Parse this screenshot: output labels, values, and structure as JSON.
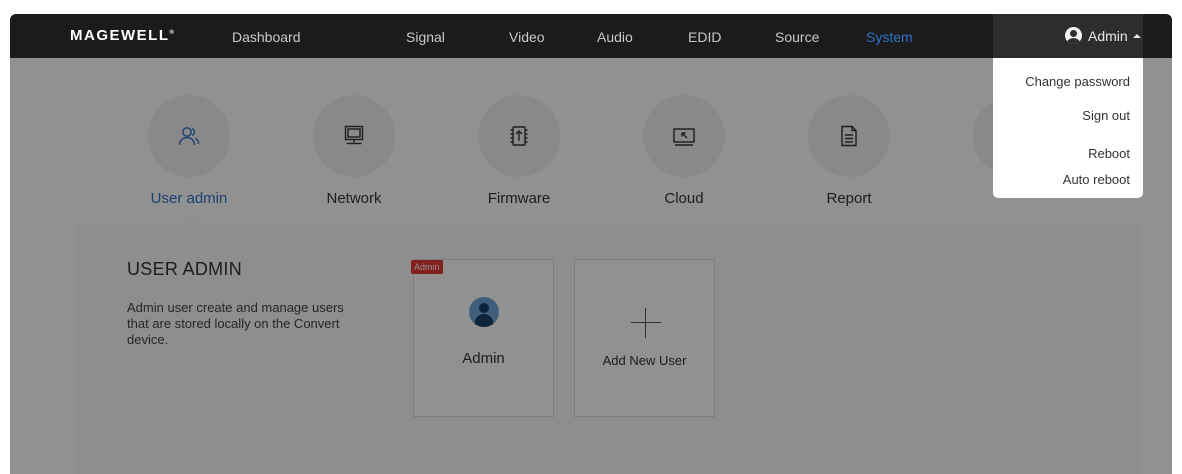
{
  "header": {
    "logo": "MAGEWELL",
    "nav": [
      "Dashboard",
      "Signal",
      "Video",
      "Audio",
      "EDID",
      "Source",
      "System"
    ],
    "active_nav": "System",
    "user": "Admin"
  },
  "dropdown": {
    "items": [
      "Change password",
      "Sign out",
      "Reboot",
      "Auto reboot"
    ]
  },
  "system_menu": [
    {
      "label": "User admin",
      "icon": "user-admin-icon"
    },
    {
      "label": "Network",
      "icon": "network-icon"
    },
    {
      "label": "Firmware",
      "icon": "firmware-icon"
    },
    {
      "label": "Cloud",
      "icon": "cloud-icon"
    },
    {
      "label": "Report",
      "icon": "report-icon"
    }
  ],
  "panel": {
    "title": "USER ADMIN",
    "description": "Admin user create and manage users that are stored locally on the Convert device."
  },
  "users": [
    {
      "badge": "Admin",
      "name": "Admin"
    }
  ],
  "add_user_label": "Add New User",
  "colors": {
    "accent": "#2f72c7",
    "badge": "#e53935",
    "topbar": "#1b1b1b"
  }
}
